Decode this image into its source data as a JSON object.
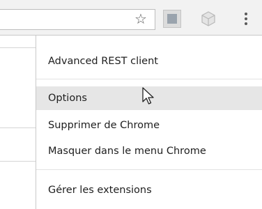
{
  "menu": {
    "extension_name": "Advanced REST client",
    "options": "Options",
    "remove": "Supprimer de Chrome",
    "hide": "Masquer dans le menu Chrome",
    "manage": "Gérer les extensions"
  },
  "icons": {
    "bookmark": "star-icon",
    "extension_1": "advanced-rest-client-icon",
    "extension_2": "cube-extension-icon",
    "menu": "three-dots-menu-icon"
  },
  "colors": {
    "hover_bg": "#e6e6e6",
    "toolbar_bg": "#f2f2f2"
  }
}
